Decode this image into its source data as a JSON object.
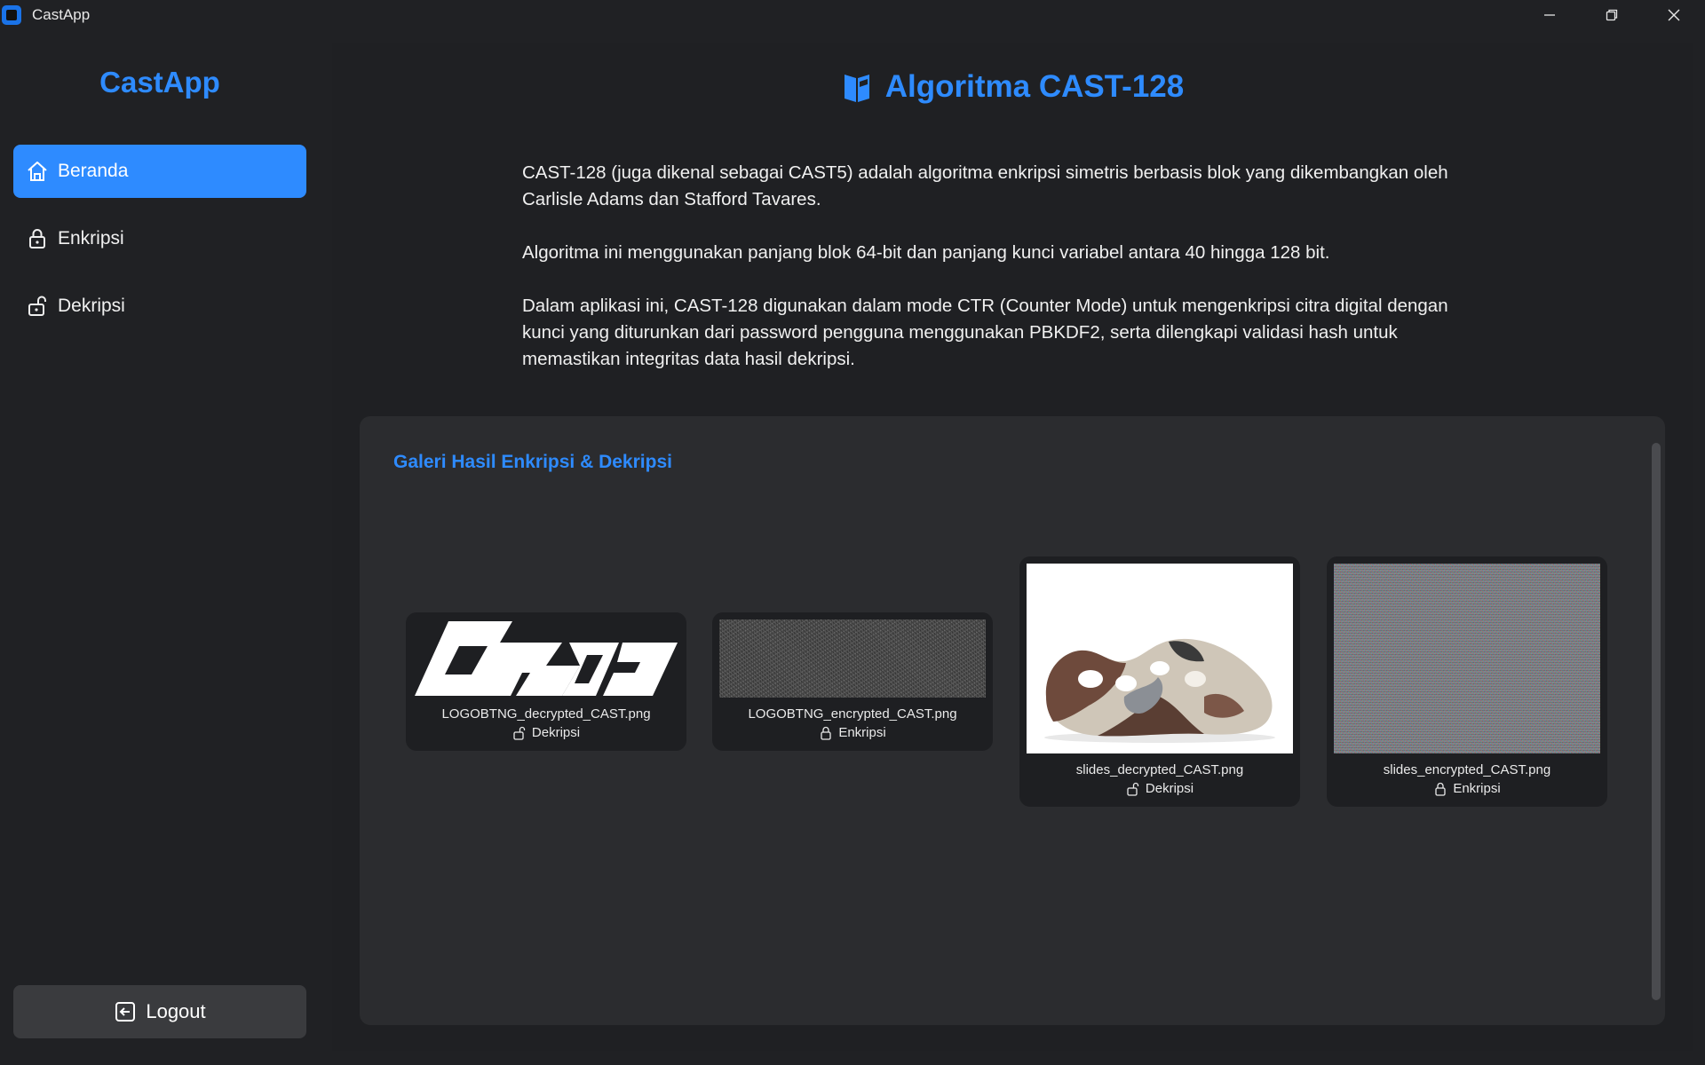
{
  "window": {
    "title": "CastApp"
  },
  "sidebar": {
    "brand": "CastApp",
    "items": [
      {
        "label": "Beranda",
        "icon": "home-icon",
        "active": true
      },
      {
        "label": "Enkripsi",
        "icon": "lock-icon",
        "active": false
      },
      {
        "label": "Dekripsi",
        "icon": "unlock-icon",
        "active": false
      }
    ],
    "logout_label": "Logout"
  },
  "main": {
    "title": "Algoritma CAST-128",
    "paragraphs": [
      "CAST-128 (juga dikenal sebagai CAST5) adalah algoritma enkripsi simetris berbasis blok yang dikembangkan oleh Carlisle Adams dan Stafford Tavares.",
      "Algoritma ini menggunakan panjang blok 64-bit dan panjang kunci variabel antara 40 hingga 128 bit.",
      "Dalam aplikasi ini, CAST-128 digunakan dalam mode CTR (Counter Mode) untuk mengenkripsi citra digital dengan kunci yang diturunkan dari password pengguna menggunakan PBKDF2, serta dilengkapi validasi hash untuk memastikan integritas data hasil dekripsi."
    ]
  },
  "gallery": {
    "title": "Galeri Hasil Enkripsi & Dekripsi",
    "items": [
      {
        "filename": "LOGOBTNG_decrypted_CAST.png",
        "tag": "Dekripsi",
        "tag_icon": "unlock-icon"
      },
      {
        "filename": "LOGOBTNG_encrypted_CAST.png",
        "tag": "Enkripsi",
        "tag_icon": "lock-icon"
      },
      {
        "filename": "slides_decrypted_CAST.png",
        "tag": "Dekripsi",
        "tag_icon": "unlock-icon"
      },
      {
        "filename": "slides_encrypted_CAST.png",
        "tag": "Enkripsi",
        "tag_icon": "lock-icon"
      }
    ]
  },
  "colors": {
    "accent": "#2e8bff",
    "background": "#1f2023",
    "panel": "#2b2c2f"
  }
}
